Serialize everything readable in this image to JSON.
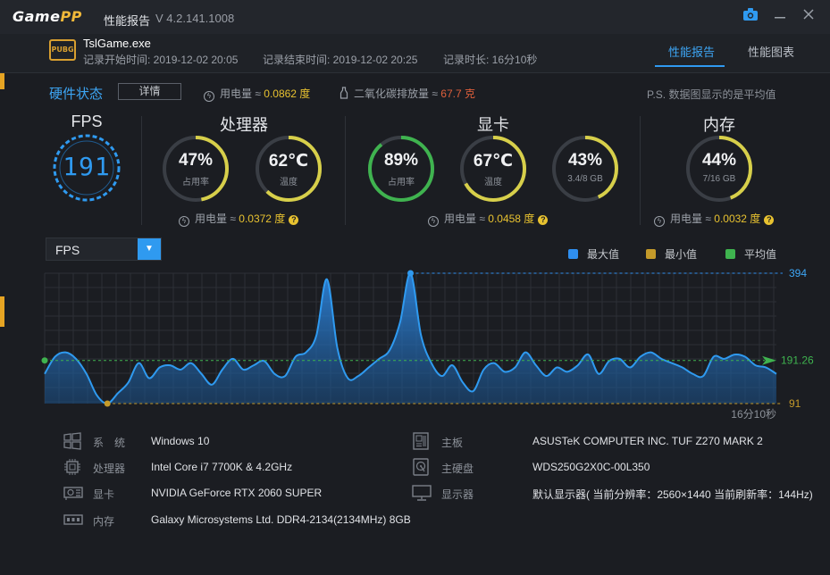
{
  "titlebar": {
    "logo_main": "Game",
    "logo_accent": "PP",
    "title": "性能报告",
    "version": "V 4.2.141.1008"
  },
  "header": {
    "game_badge": "PUBG",
    "exe": "TslGame.exe",
    "start": "记录开始时间: 2019-12-02 20:05",
    "end": "记录结束时间: 2019-12-02 20:25",
    "duration": "记录时长: 16分10秒",
    "tabs": [
      {
        "label": "性能报告",
        "active": true
      },
      {
        "label": "性能图表",
        "active": false
      }
    ]
  },
  "status": {
    "hw_title": "硬件状态",
    "detail_btn": "详情",
    "power_label": "用电量 ≈ ",
    "power_value": "0.0862 度",
    "co2_label": "二氧化碳排放量 ≈ ",
    "co2_value": "67.7 克",
    "note": "P.S. 数据图显示的是平均值"
  },
  "fps": {
    "title": "FPS",
    "value": "191"
  },
  "cpu": {
    "title": "处理器",
    "usage": {
      "value": "47%",
      "label": "占用率",
      "fraction": 0.47
    },
    "temp": {
      "value": "62℃",
      "label": "温度",
      "fraction": 0.62
    },
    "power_label": "用电量 ≈ ",
    "power_value": "0.0372 度"
  },
  "gpu": {
    "title": "显卡",
    "usage": {
      "value": "89%",
      "label": "占用率",
      "fraction": 0.89
    },
    "temp": {
      "value": "67℃",
      "label": "温度",
      "fraction": 0.67
    },
    "mem": {
      "value": "43%",
      "label": "3.4/8 GB",
      "fraction": 0.43
    },
    "power_label": "用电量 ≈ ",
    "power_value": "0.0458 度"
  },
  "ram": {
    "title": "内存",
    "usage": {
      "value": "44%",
      "label": "7/16 GB",
      "fraction": 0.44
    },
    "power_label": "用电量 ≈ ",
    "power_value": "0.0032 度"
  },
  "chart_header": {
    "select_value": "FPS",
    "legend": [
      {
        "label": "最大值",
        "color": "#2f8ff0"
      },
      {
        "label": "最小值",
        "color": "#c49a2a"
      },
      {
        "label": "平均值",
        "color": "#3fb34f"
      }
    ]
  },
  "chart_data": {
    "type": "area",
    "max": 394,
    "avg": 191.26,
    "min": 91,
    "max_label": "394",
    "avg_label": "191.26",
    "min_label": "91",
    "x_end_label": "16分10秒",
    "y": [
      160,
      200,
      210,
      195,
      160,
      110,
      91,
      115,
      140,
      185,
      150,
      175,
      180,
      170,
      185,
      160,
      135,
      170,
      195,
      170,
      180,
      190,
      160,
      155,
      200,
      210,
      250,
      380,
      220,
      150,
      155,
      175,
      195,
      215,
      280,
      394,
      250,
      185,
      155,
      180,
      140,
      120,
      170,
      185,
      165,
      175,
      210,
      180,
      155,
      175,
      165,
      180,
      205,
      160,
      190,
      195,
      175,
      200,
      210,
      195,
      185,
      175,
      160,
      155,
      200,
      195,
      205,
      200,
      180,
      175,
      160
    ],
    "ylim": [
      91,
      394
    ]
  },
  "sysinfo": {
    "left": [
      {
        "key": "系　统",
        "value": "Windows 10",
        "icon": "windows-icon"
      },
      {
        "key": "处理器",
        "value": "Intel Core i7 7700K & 4.2GHz",
        "icon": "cpu-icon"
      },
      {
        "key": "显卡",
        "value": "NVIDIA GeForce RTX 2060 SUPER",
        "icon": "gpu-icon"
      },
      {
        "key": "内存",
        "value": "Galaxy Microsystems Ltd. DDR4-2134(2134MHz) 8GB",
        "icon": "ram-icon"
      }
    ],
    "right": [
      {
        "key": "主板",
        "value": "ASUSTeK COMPUTER INC. TUF Z270 MARK 2",
        "icon": "motherboard-icon"
      },
      {
        "key": "主硬盘",
        "value": "WDS250G2X0C-00L350",
        "icon": "disk-icon"
      },
      {
        "key": "显示器",
        "value": "默认显示器( 当前分辨率：2560×1440 当前刷新率：144Hz)",
        "icon": "monitor-icon"
      }
    ]
  },
  "colors": {
    "accent": "#2f9af0",
    "gauge_green": "#3fb34f",
    "gauge_yellow": "#d7cf4a",
    "power": "#e8c230",
    "co2": "#e0603c"
  }
}
